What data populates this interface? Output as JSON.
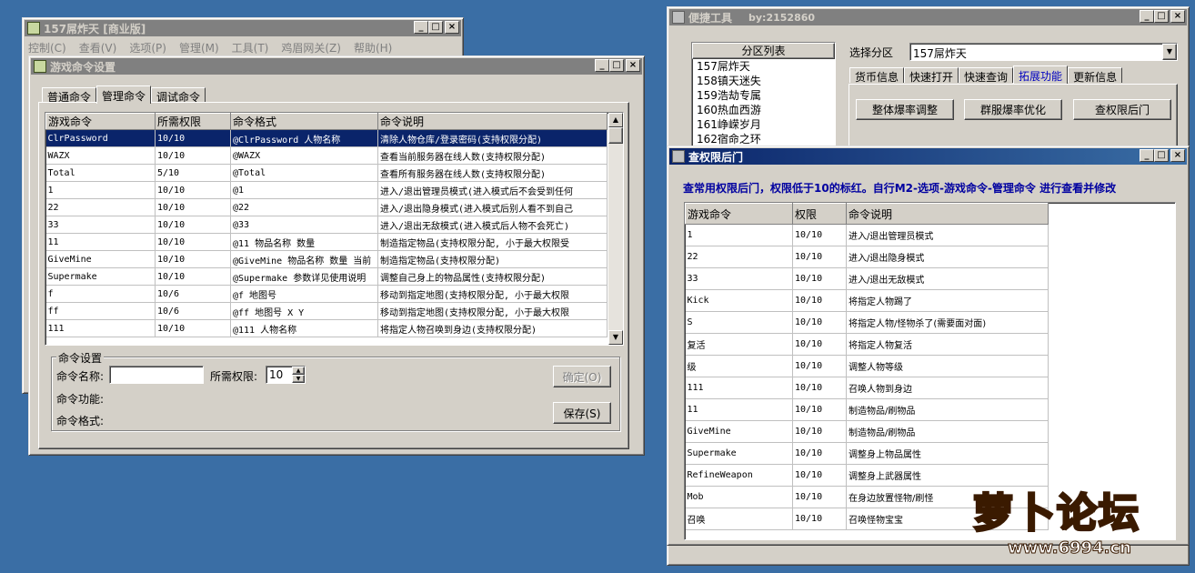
{
  "bg_window": {
    "title": "157屌炸天 [商业版]",
    "menu": [
      "控制(C)",
      "查看(V)",
      "选项(P)",
      "管理(M)",
      "工具(T)",
      "鸡眉网关(Z)",
      "帮助(H)"
    ]
  },
  "cmd_window": {
    "title": "游戏命令设置",
    "tabs": [
      "普通命令",
      "管理命令",
      "调试命令"
    ],
    "columns": [
      "游戏命令",
      "所需权限",
      "命令格式",
      "命令说明"
    ],
    "rows": [
      [
        "ClrPassword",
        "10/10",
        "@ClrPassword 人物名称",
        "清除人物仓库/登录密码(支持权限分配)"
      ],
      [
        "WAZX",
        "10/10",
        "@WAZX",
        "查看当前服务器在线人数(支持权限分配)"
      ],
      [
        "Total",
        "5/10",
        "@Total",
        "查看所有服务器在线人数(支持权限分配)"
      ],
      [
        "1",
        "10/10",
        "@1",
        "进入/退出管理员模式(进入模式后不会受到任何"
      ],
      [
        "22",
        "10/10",
        "@22",
        "进入/退出隐身模式(进入模式后别人看不到自己"
      ],
      [
        "33",
        "10/10",
        "@33",
        "进入/退出无敌模式(进入模式后人物不会死亡)"
      ],
      [
        "11",
        "10/10",
        "@11 物品名称 数量",
        "制造指定物品(支持权限分配, 小于最大权限受"
      ],
      [
        "GiveMine",
        "10/10",
        "@GiveMine 物品名称 数量 当前",
        "制造指定物品(支持权限分配)"
      ],
      [
        "Supermake",
        "10/10",
        "@Supermake 参数详见使用说明",
        "调整自己身上的物品属性(支持权限分配)"
      ],
      [
        "f",
        "10/6",
        "@f 地图号",
        "移动到指定地图(支持权限分配, 小于最大权限"
      ],
      [
        "ff",
        "10/6",
        "@ff 地图号 X Y",
        "移动到指定地图(支持权限分配, 小于最大权限"
      ],
      [
        "111",
        "10/10",
        "@111 人物名称",
        "将指定人物召唤到身边(支持权限分配)"
      ]
    ],
    "group_title": "命令设置",
    "name_label": "命令名称:",
    "name_value": "",
    "perm_label": "所需权限:",
    "perm_value": "10",
    "func_label": "命令功能:",
    "format_label": "命令格式:",
    "confirm_btn": "确定(O)",
    "save_btn": "保存(S)"
  },
  "tools_window": {
    "title": "便捷工具",
    "byline": "by:2152860",
    "list_title": "分区列表",
    "partitions": [
      "157屌炸天",
      "158镇天迷失",
      "159浩劫专属",
      "160热血西游",
      "161峥嵘岁月",
      "162宿命之环"
    ],
    "select_label": "选择分区",
    "select_value": "157屌炸天",
    "tabs": [
      "货币信息",
      "快速打开",
      "快速查询",
      "拓展功能",
      "更新信息"
    ],
    "buttons": [
      "整体爆率调整",
      "群服爆率优化",
      "查权限后门"
    ]
  },
  "perm_window": {
    "title": "查权限后门",
    "note": "查常用权限后门，权限低于10的标红。自行M2-选项-游戏命令-管理命令 进行查看并修改",
    "columns": [
      "游戏命令",
      "权限",
      "命令说明"
    ],
    "rows": [
      [
        "1",
        "10/10",
        "进入/退出管理员模式"
      ],
      [
        "22",
        "10/10",
        "进入/退出隐身模式"
      ],
      [
        "33",
        "10/10",
        "进入/退出无敌模式"
      ],
      [
        "Kick",
        "10/10",
        "将指定人物踢了"
      ],
      [
        "S",
        "10/10",
        "将指定人物/怪物杀了(需要面对面)"
      ],
      [
        "复活",
        "10/10",
        "将指定人物复活"
      ],
      [
        "级",
        "10/10",
        "调整人物等级"
      ],
      [
        "111",
        "10/10",
        "召唤人物到身边"
      ],
      [
        "11",
        "10/10",
        "制造物品/刷物品"
      ],
      [
        "GiveMine",
        "10/10",
        "制造物品/刷物品"
      ],
      [
        "Supermake",
        "10/10",
        "调整身上物品属性"
      ],
      [
        "RefineWeapon",
        "10/10",
        "调整身上武器属性"
      ],
      [
        "Mob",
        "10/10",
        "在身边放置怪物/刷怪"
      ],
      [
        "召唤",
        "10/10",
        "召唤怪物宝宝"
      ]
    ]
  },
  "watermark": {
    "text": "萝卜论坛",
    "url": "www.6994.cn"
  },
  "colors": {
    "desktop": "#3a6ea5",
    "active_title": "#0a246a",
    "selection": "#0a246a",
    "note_text": "#0000a0"
  }
}
